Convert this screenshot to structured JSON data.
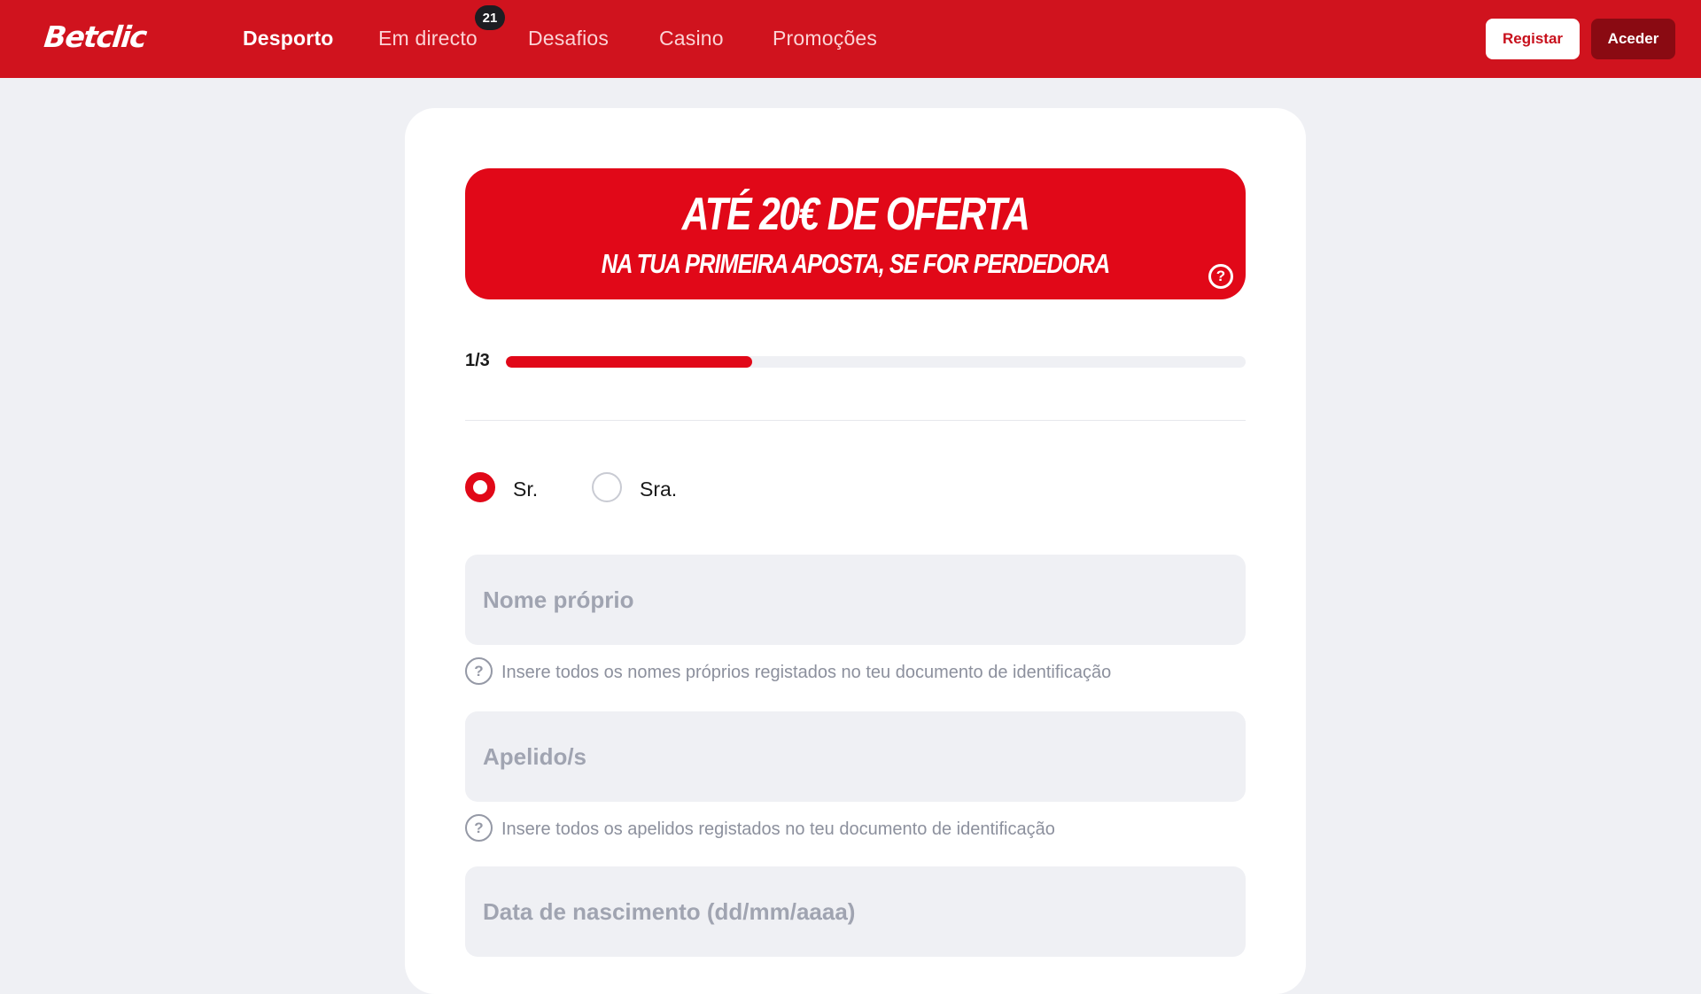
{
  "header": {
    "logo": "Betclic",
    "nav": [
      {
        "label": "Desporto",
        "active": true
      },
      {
        "label": "Em directo",
        "active": false,
        "badge": "21"
      },
      {
        "label": "Desafios",
        "active": false
      },
      {
        "label": "Casino",
        "active": false
      },
      {
        "label": "Promoções",
        "active": false
      }
    ],
    "register_label": "Registar",
    "login_label": "Aceder"
  },
  "promo": {
    "title": "ATÉ 20€ DE OFERTA",
    "subtitle": "NA TUA PRIMEIRA APOSTA, SE FOR PERDEDORA",
    "help_glyph": "?"
  },
  "progress": {
    "label": "1/3",
    "value": 0.333
  },
  "form": {
    "title_options": [
      {
        "label": "Sr.",
        "checked": true
      },
      {
        "label": "Sra.",
        "checked": false
      }
    ],
    "first_name": {
      "value": "",
      "placeholder": "Nome próprio",
      "hint": "Insere todos os nomes próprios registados no teu documento de identificação"
    },
    "last_name": {
      "value": "",
      "placeholder": "Apelido/s",
      "hint": "Insere todos os apelidos registados no teu documento de identificação"
    },
    "birth_date": {
      "value": "",
      "placeholder": "Data de nascimento (dd/mm/aaaa)"
    },
    "hint_glyph": "?"
  },
  "colors": {
    "brand_red": "#d0131e",
    "accent_red": "#e10818",
    "field_bg": "#eff0f4"
  },
  "icons": {
    "help": "question-circle-icon"
  }
}
